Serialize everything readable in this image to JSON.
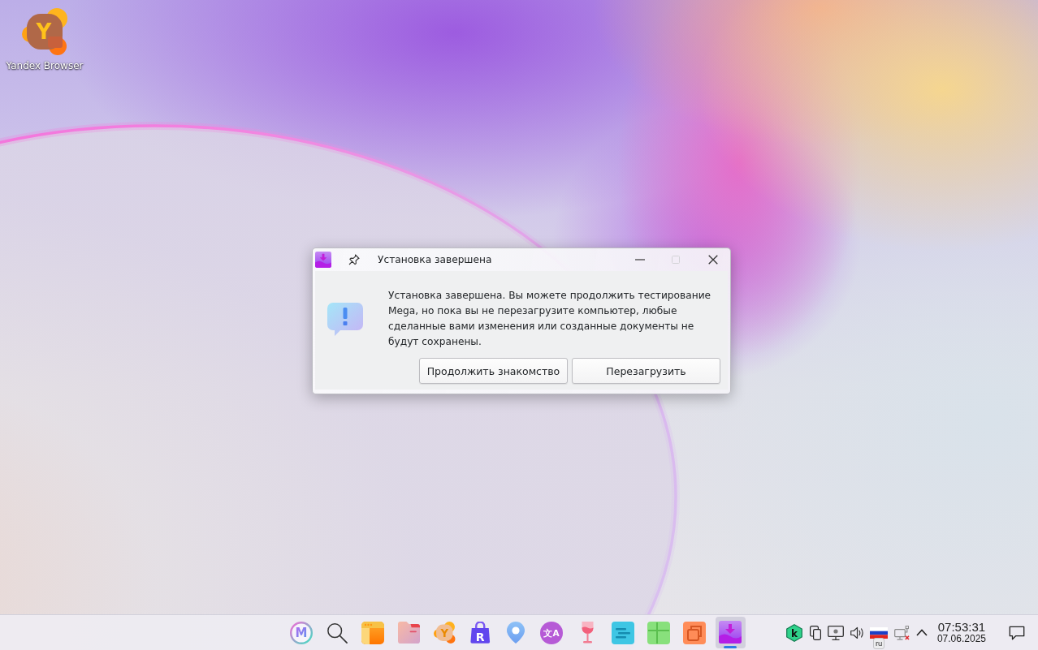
{
  "desktop": {
    "shortcuts": [
      {
        "label": "Yandex Browser",
        "glyph": "Y"
      }
    ]
  },
  "dialog": {
    "title": "Установка завершена",
    "controls": [
      {
        "kind": "minimize",
        "disabled": false
      },
      {
        "kind": "maximize",
        "disabled": true
      },
      {
        "kind": "close",
        "disabled": false
      }
    ],
    "message": "Установка завершена. Вы можете продолжить тестирование Mega, но пока вы не перезагрузите компьютер, любые сделанные вами изменения или созданные документы не будут сохранены.",
    "buttons": [
      {
        "label": "Продолжить знакомство"
      },
      {
        "label": "Перезагрузить"
      }
    ]
  },
  "taskbar": {
    "apps": [
      {
        "kind": "launcher",
        "glyph": "M",
        "active": false
      },
      {
        "kind": "search",
        "active": false
      },
      {
        "kind": "window",
        "active": false
      },
      {
        "kind": "folder",
        "active": false
      },
      {
        "kind": "browser",
        "glyph": "Y",
        "active": false
      },
      {
        "kind": "store",
        "glyph": "R",
        "active": false
      },
      {
        "kind": "maps",
        "active": false
      },
      {
        "kind": "translate",
        "glyph": "文A",
        "active": false
      },
      {
        "kind": "glass",
        "active": false
      },
      {
        "kind": "notes",
        "active": false
      },
      {
        "kind": "grid",
        "active": false
      },
      {
        "kind": "squares",
        "active": false
      },
      {
        "kind": "installer",
        "active": true
      }
    ],
    "tray": [
      {
        "kind": "security",
        "glyph": "k"
      },
      {
        "kind": "clipboard"
      },
      {
        "kind": "display"
      },
      {
        "kind": "volume"
      },
      {
        "kind": "layout",
        "label": "ru"
      },
      {
        "kind": "network",
        "connected": false
      },
      {
        "kind": "expand"
      },
      {
        "kind": "clock",
        "time": "07:53:31",
        "date": "07.06.2025"
      },
      {
        "kind": "notifications"
      }
    ]
  }
}
